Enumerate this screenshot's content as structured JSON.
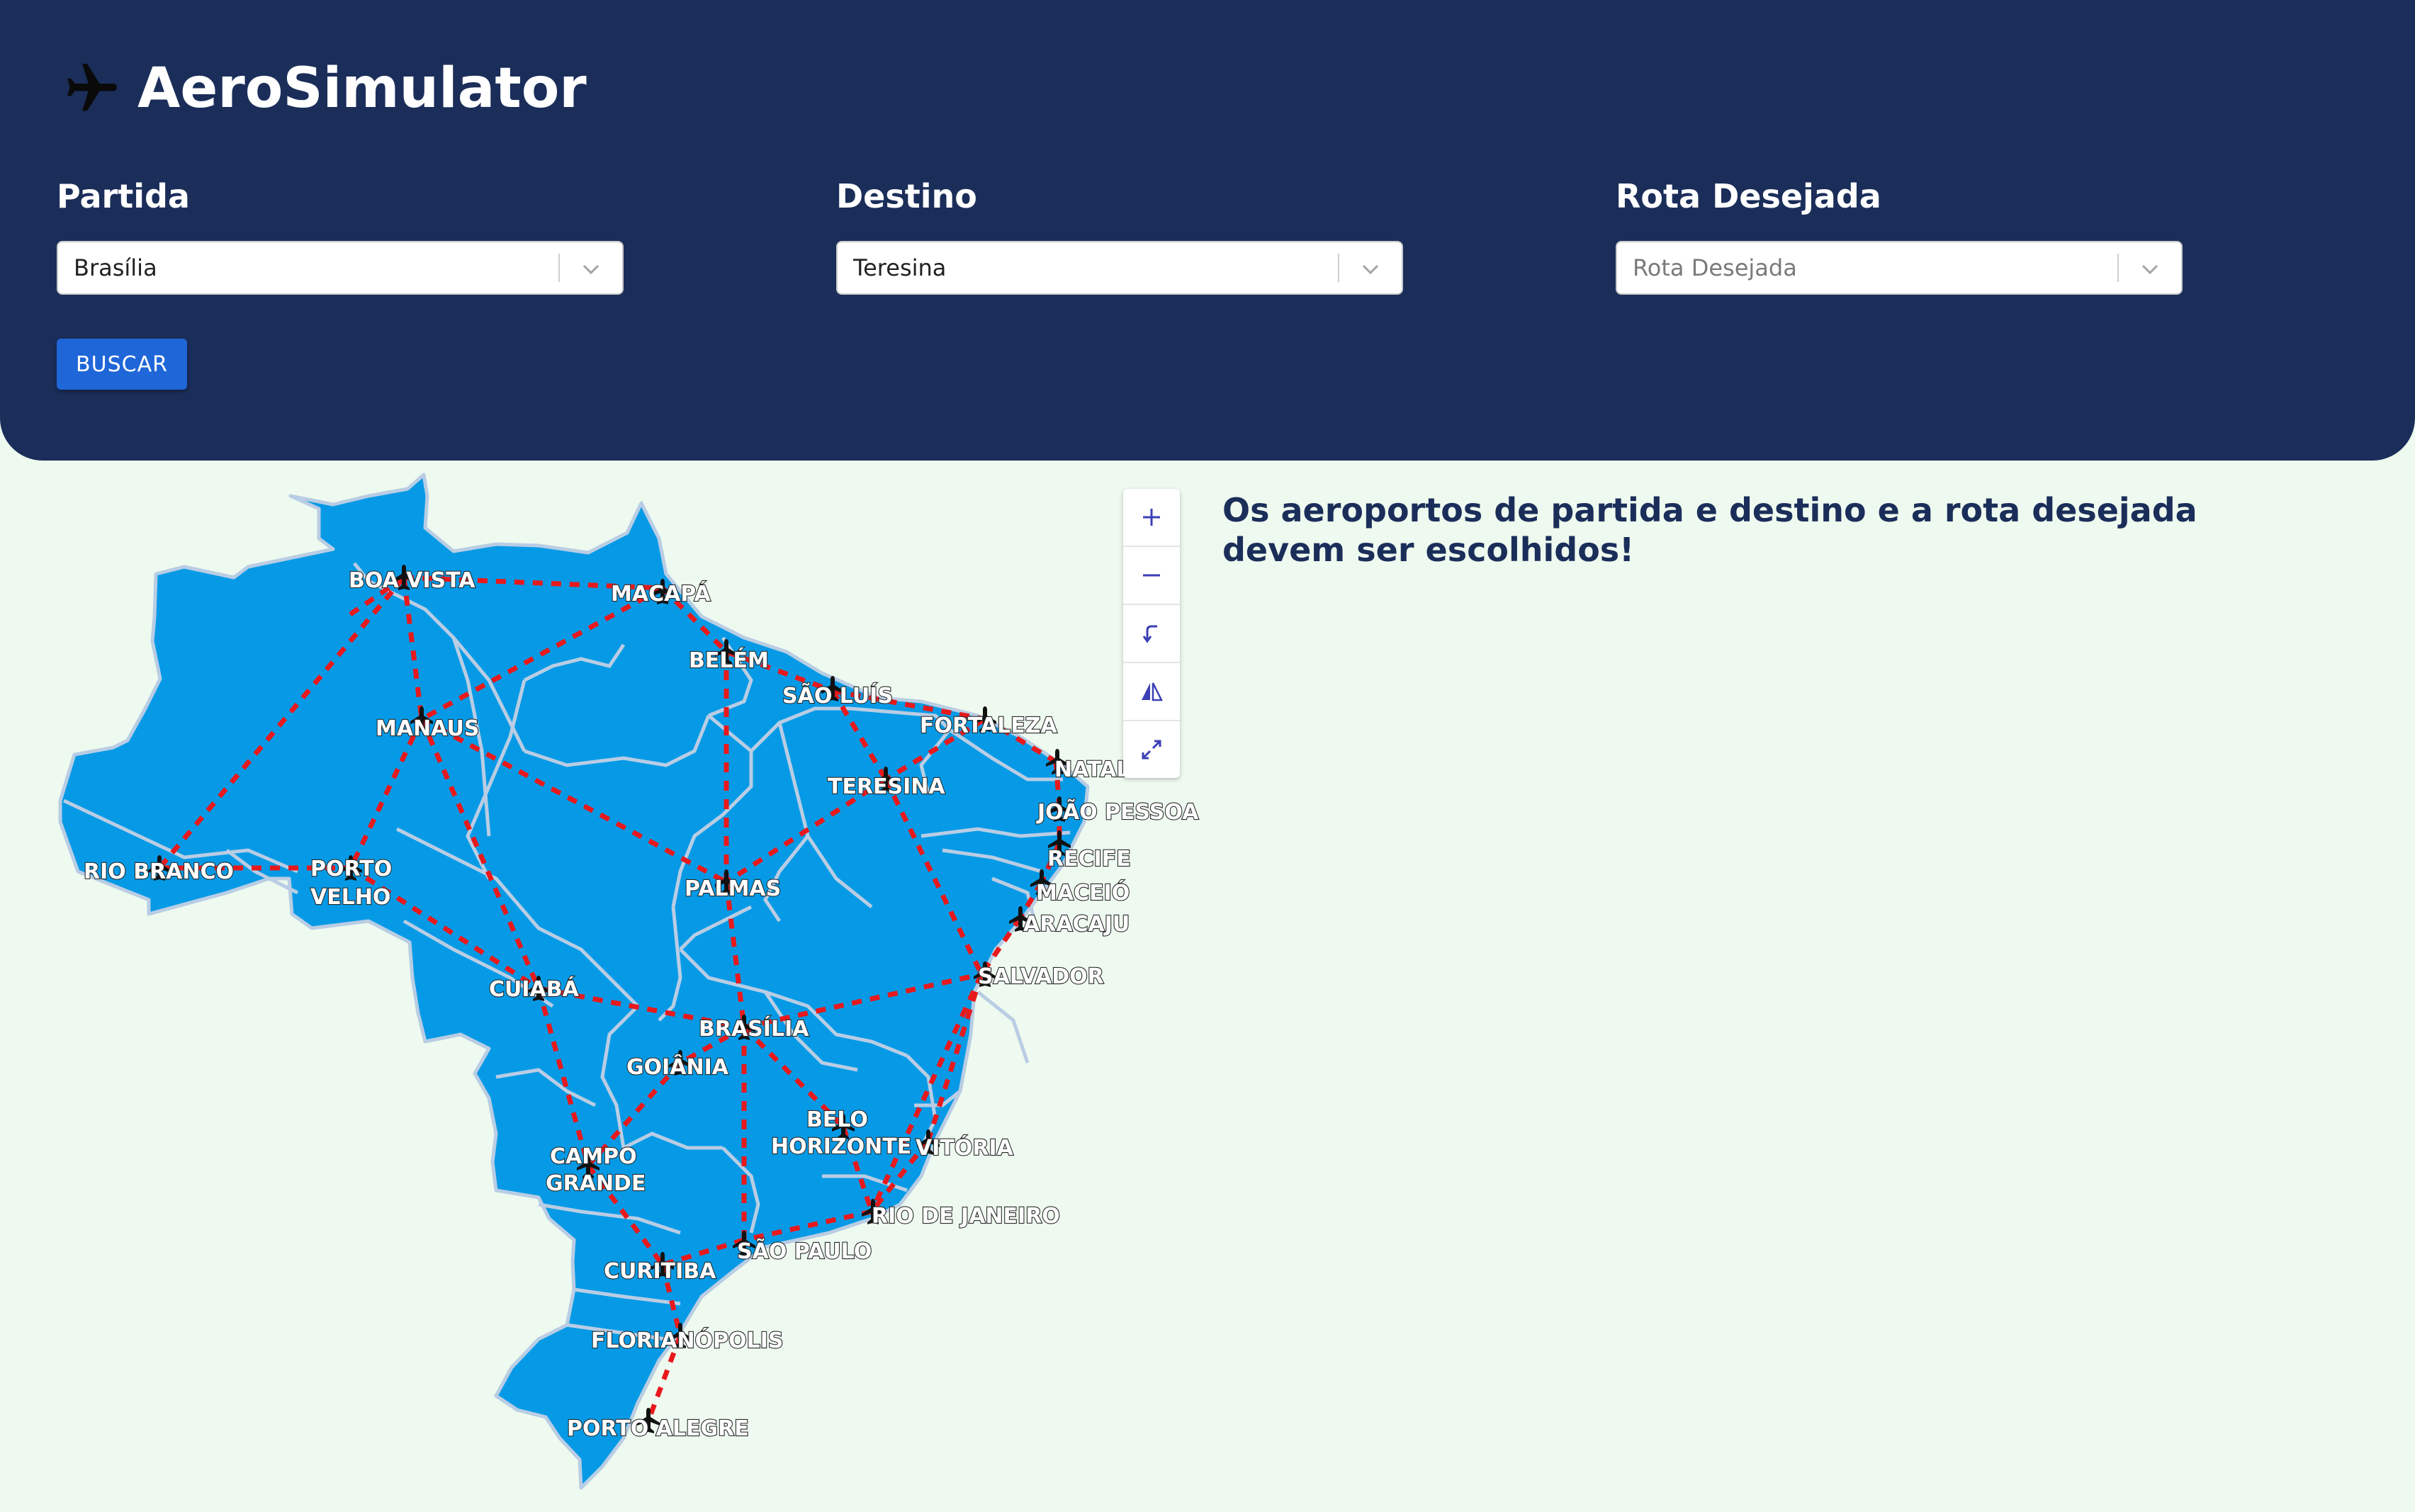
{
  "app": {
    "title": "AeroSimulator",
    "logo_icon": "airplane-icon"
  },
  "form": {
    "departure": {
      "label": "Partida",
      "value": "Brasília"
    },
    "destination": {
      "label": "Destino",
      "value": "Teresina"
    },
    "route": {
      "label": "Rota Desejada",
      "placeholder": "Rota Desejada"
    },
    "search_button": "BUSCAR"
  },
  "message": "Os aeroportos de partida e destino e a rota desejada devem ser escolhidos!",
  "zoom_controls": [
    "zoom-in-icon",
    "zoom-out-icon",
    "reset-rotation-icon",
    "tilt-icon",
    "fullscreen-icon"
  ],
  "colors": {
    "header_bg": "#1b2e5a",
    "page_bg": "#eefaef",
    "map_fill": "#069ae6",
    "route": "#e8191c",
    "button": "#1f66d8"
  },
  "cities": {
    "boa_vista": "BOA VISTA",
    "macapa": "MACAPÁ",
    "belem": "BELÉM",
    "sao_luis": "SÃO LUÍS",
    "fortaleza": "FORTALEZA",
    "natal": "NATAL",
    "joao_pessoa": "JOÃO PESSOA",
    "recife": "RECIFE",
    "maceio": "MACEIÓ",
    "aracaju": "ARACAJU",
    "salvador": "SALVADOR",
    "manaus": "MANAUS",
    "teresina": "TERESINA",
    "rio_branco": "RIO BRANCO",
    "porto_velho_1": "PORTO",
    "porto_velho_2": "VELHO",
    "palmas": "PALMAS",
    "cuiaba": "CUIABÁ",
    "brasilia": "BRASÍLIA",
    "goiania": "GOIÂNIA",
    "belo_horizonte_1": "BELO",
    "belo_horizonte_2": "HORIZONTE",
    "vitoria": "VITÓRIA",
    "campo_grande_1": "CAMPO",
    "campo_grande_2": "GRANDE",
    "rio_de_janeiro": "RIO DE JANEIRO",
    "sao_paulo": "SÃO PAULO",
    "curitiba": "CURITIBA",
    "florianopolis": "FLORIANÓPOLIS",
    "porto_alegre": "PORTO ALEGRE"
  }
}
